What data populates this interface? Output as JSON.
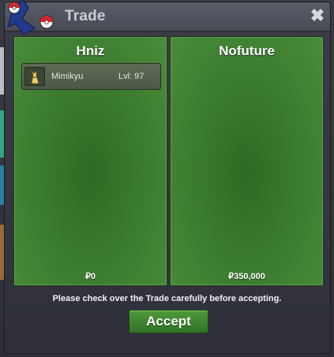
{
  "window": {
    "title": "Trade",
    "close_label": "✖"
  },
  "panels": [
    {
      "player": "Hniz",
      "items": [
        {
          "name": "Mimikyu",
          "level": "Lvl: 97"
        }
      ],
      "money": "₽0"
    },
    {
      "player": "Nofuture",
      "items": [],
      "money": "₽350,000"
    }
  ],
  "notice": "Please check over the Trade carefully before accepting.",
  "accept_label": "Accept",
  "colors": {
    "panel_green": "#3a7a2e",
    "button_green": "#3f8a30",
    "window_bg": "#2f3039"
  }
}
